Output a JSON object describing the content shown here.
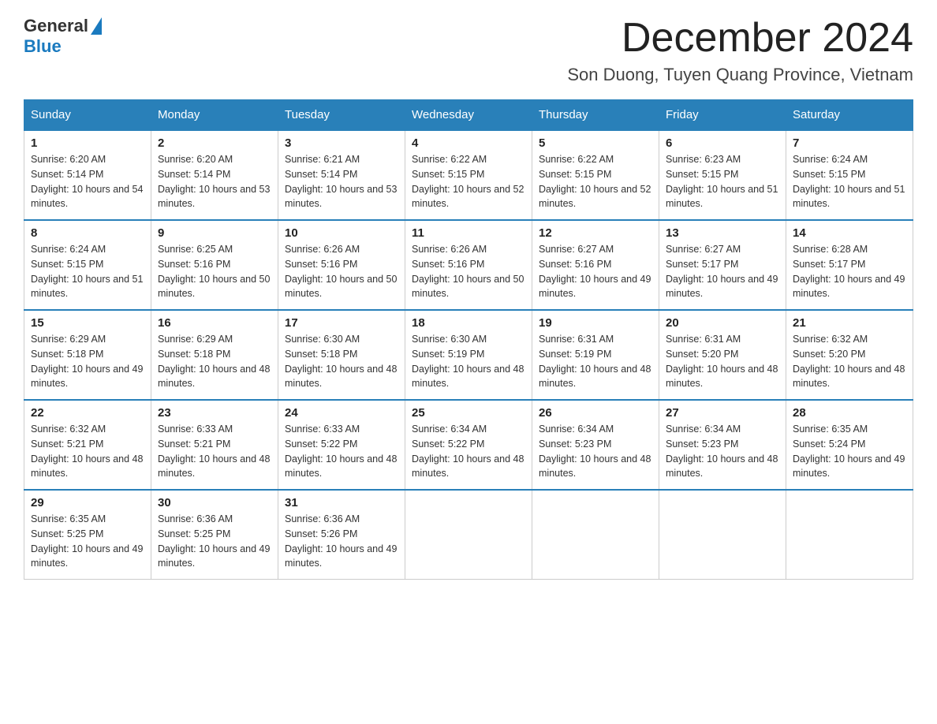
{
  "header": {
    "logo_general": "General",
    "logo_blue": "Blue",
    "title": "December 2024",
    "location": "Son Duong, Tuyen Quang Province, Vietnam"
  },
  "days_of_week": [
    "Sunday",
    "Monday",
    "Tuesday",
    "Wednesday",
    "Thursday",
    "Friday",
    "Saturday"
  ],
  "weeks": [
    [
      {
        "day": "1",
        "sunrise": "6:20 AM",
        "sunset": "5:14 PM",
        "daylight": "10 hours and 54 minutes."
      },
      {
        "day": "2",
        "sunrise": "6:20 AM",
        "sunset": "5:14 PM",
        "daylight": "10 hours and 53 minutes."
      },
      {
        "day": "3",
        "sunrise": "6:21 AM",
        "sunset": "5:14 PM",
        "daylight": "10 hours and 53 minutes."
      },
      {
        "day": "4",
        "sunrise": "6:22 AM",
        "sunset": "5:15 PM",
        "daylight": "10 hours and 52 minutes."
      },
      {
        "day": "5",
        "sunrise": "6:22 AM",
        "sunset": "5:15 PM",
        "daylight": "10 hours and 52 minutes."
      },
      {
        "day": "6",
        "sunrise": "6:23 AM",
        "sunset": "5:15 PM",
        "daylight": "10 hours and 51 minutes."
      },
      {
        "day": "7",
        "sunrise": "6:24 AM",
        "sunset": "5:15 PM",
        "daylight": "10 hours and 51 minutes."
      }
    ],
    [
      {
        "day": "8",
        "sunrise": "6:24 AM",
        "sunset": "5:15 PM",
        "daylight": "10 hours and 51 minutes."
      },
      {
        "day": "9",
        "sunrise": "6:25 AM",
        "sunset": "5:16 PM",
        "daylight": "10 hours and 50 minutes."
      },
      {
        "day": "10",
        "sunrise": "6:26 AM",
        "sunset": "5:16 PM",
        "daylight": "10 hours and 50 minutes."
      },
      {
        "day": "11",
        "sunrise": "6:26 AM",
        "sunset": "5:16 PM",
        "daylight": "10 hours and 50 minutes."
      },
      {
        "day": "12",
        "sunrise": "6:27 AM",
        "sunset": "5:16 PM",
        "daylight": "10 hours and 49 minutes."
      },
      {
        "day": "13",
        "sunrise": "6:27 AM",
        "sunset": "5:17 PM",
        "daylight": "10 hours and 49 minutes."
      },
      {
        "day": "14",
        "sunrise": "6:28 AM",
        "sunset": "5:17 PM",
        "daylight": "10 hours and 49 minutes."
      }
    ],
    [
      {
        "day": "15",
        "sunrise": "6:29 AM",
        "sunset": "5:18 PM",
        "daylight": "10 hours and 49 minutes."
      },
      {
        "day": "16",
        "sunrise": "6:29 AM",
        "sunset": "5:18 PM",
        "daylight": "10 hours and 48 minutes."
      },
      {
        "day": "17",
        "sunrise": "6:30 AM",
        "sunset": "5:18 PM",
        "daylight": "10 hours and 48 minutes."
      },
      {
        "day": "18",
        "sunrise": "6:30 AM",
        "sunset": "5:19 PM",
        "daylight": "10 hours and 48 minutes."
      },
      {
        "day": "19",
        "sunrise": "6:31 AM",
        "sunset": "5:19 PM",
        "daylight": "10 hours and 48 minutes."
      },
      {
        "day": "20",
        "sunrise": "6:31 AM",
        "sunset": "5:20 PM",
        "daylight": "10 hours and 48 minutes."
      },
      {
        "day": "21",
        "sunrise": "6:32 AM",
        "sunset": "5:20 PM",
        "daylight": "10 hours and 48 minutes."
      }
    ],
    [
      {
        "day": "22",
        "sunrise": "6:32 AM",
        "sunset": "5:21 PM",
        "daylight": "10 hours and 48 minutes."
      },
      {
        "day": "23",
        "sunrise": "6:33 AM",
        "sunset": "5:21 PM",
        "daylight": "10 hours and 48 minutes."
      },
      {
        "day": "24",
        "sunrise": "6:33 AM",
        "sunset": "5:22 PM",
        "daylight": "10 hours and 48 minutes."
      },
      {
        "day": "25",
        "sunrise": "6:34 AM",
        "sunset": "5:22 PM",
        "daylight": "10 hours and 48 minutes."
      },
      {
        "day": "26",
        "sunrise": "6:34 AM",
        "sunset": "5:23 PM",
        "daylight": "10 hours and 48 minutes."
      },
      {
        "day": "27",
        "sunrise": "6:34 AM",
        "sunset": "5:23 PM",
        "daylight": "10 hours and 48 minutes."
      },
      {
        "day": "28",
        "sunrise": "6:35 AM",
        "sunset": "5:24 PM",
        "daylight": "10 hours and 49 minutes."
      }
    ],
    [
      {
        "day": "29",
        "sunrise": "6:35 AM",
        "sunset": "5:25 PM",
        "daylight": "10 hours and 49 minutes."
      },
      {
        "day": "30",
        "sunrise": "6:36 AM",
        "sunset": "5:25 PM",
        "daylight": "10 hours and 49 minutes."
      },
      {
        "day": "31",
        "sunrise": "6:36 AM",
        "sunset": "5:26 PM",
        "daylight": "10 hours and 49 minutes."
      },
      null,
      null,
      null,
      null
    ]
  ]
}
